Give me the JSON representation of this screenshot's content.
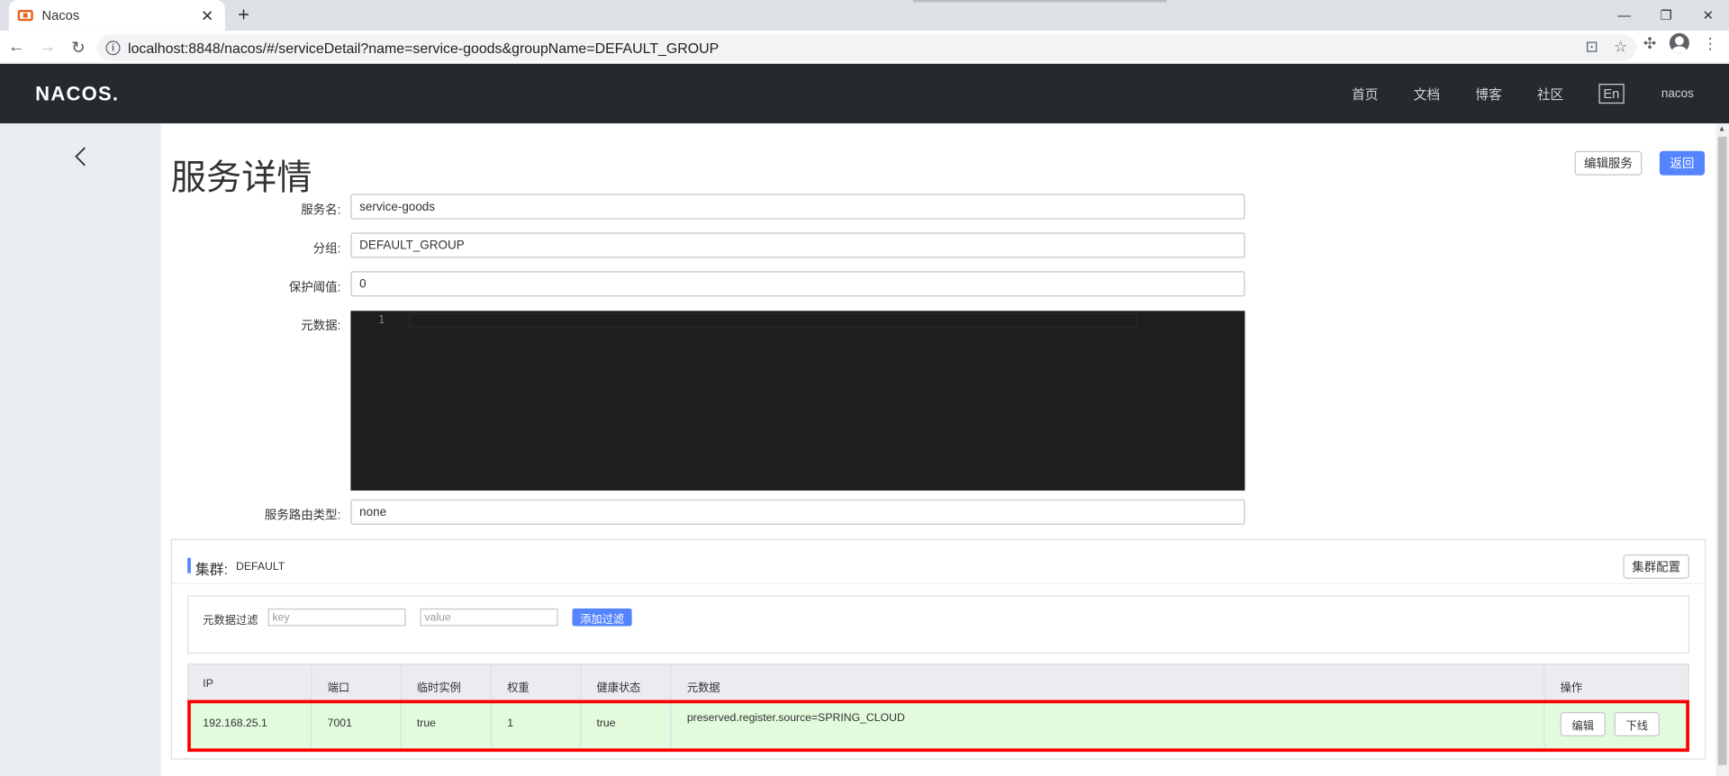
{
  "browser": {
    "tab_title": "Nacos",
    "url": "localhost:8848/nacos/#/serviceDetail?name=service-goods&groupName=DEFAULT_GROUP"
  },
  "header": {
    "logo": "NACOS.",
    "nav": [
      "首页",
      "文档",
      "博客",
      "社区"
    ],
    "lang": "En",
    "user": "nacos"
  },
  "page": {
    "title": "服务详情",
    "edit_service_label": "编辑服务",
    "back_label": "返回"
  },
  "form": {
    "service_name_label": "服务名:",
    "service_name": "service-goods",
    "group_label": "分组:",
    "group": "DEFAULT_GROUP",
    "threshold_label": "保护阈值:",
    "threshold": "0",
    "metadata_label": "元数据:",
    "metadata_line": "1",
    "selector_label": "服务路由类型:",
    "selector": "none"
  },
  "cluster": {
    "title": "集群:",
    "name": "DEFAULT",
    "config_label": "集群配置",
    "filter_label": "元数据过滤",
    "key_placeholder": "key",
    "value_placeholder": "value",
    "add_filter_label": "添加过滤",
    "columns": [
      "IP",
      "端口",
      "临时实例",
      "权重",
      "健康状态",
      "元数据",
      "操作"
    ],
    "rows": [
      {
        "ip": "192.168.25.1",
        "port": "7001",
        "ephemeral": "true",
        "weight": "1",
        "healthy": "true",
        "metadata": "preserved.register.source=SPRING_CLOUD",
        "edit_label": "编辑",
        "offline_label": "下线"
      }
    ]
  },
  "colors": {
    "header_bg": "#252a2f",
    "primary": "#5584ff",
    "row_bg": "#e2fbdd",
    "highlight": "#ff0000"
  }
}
